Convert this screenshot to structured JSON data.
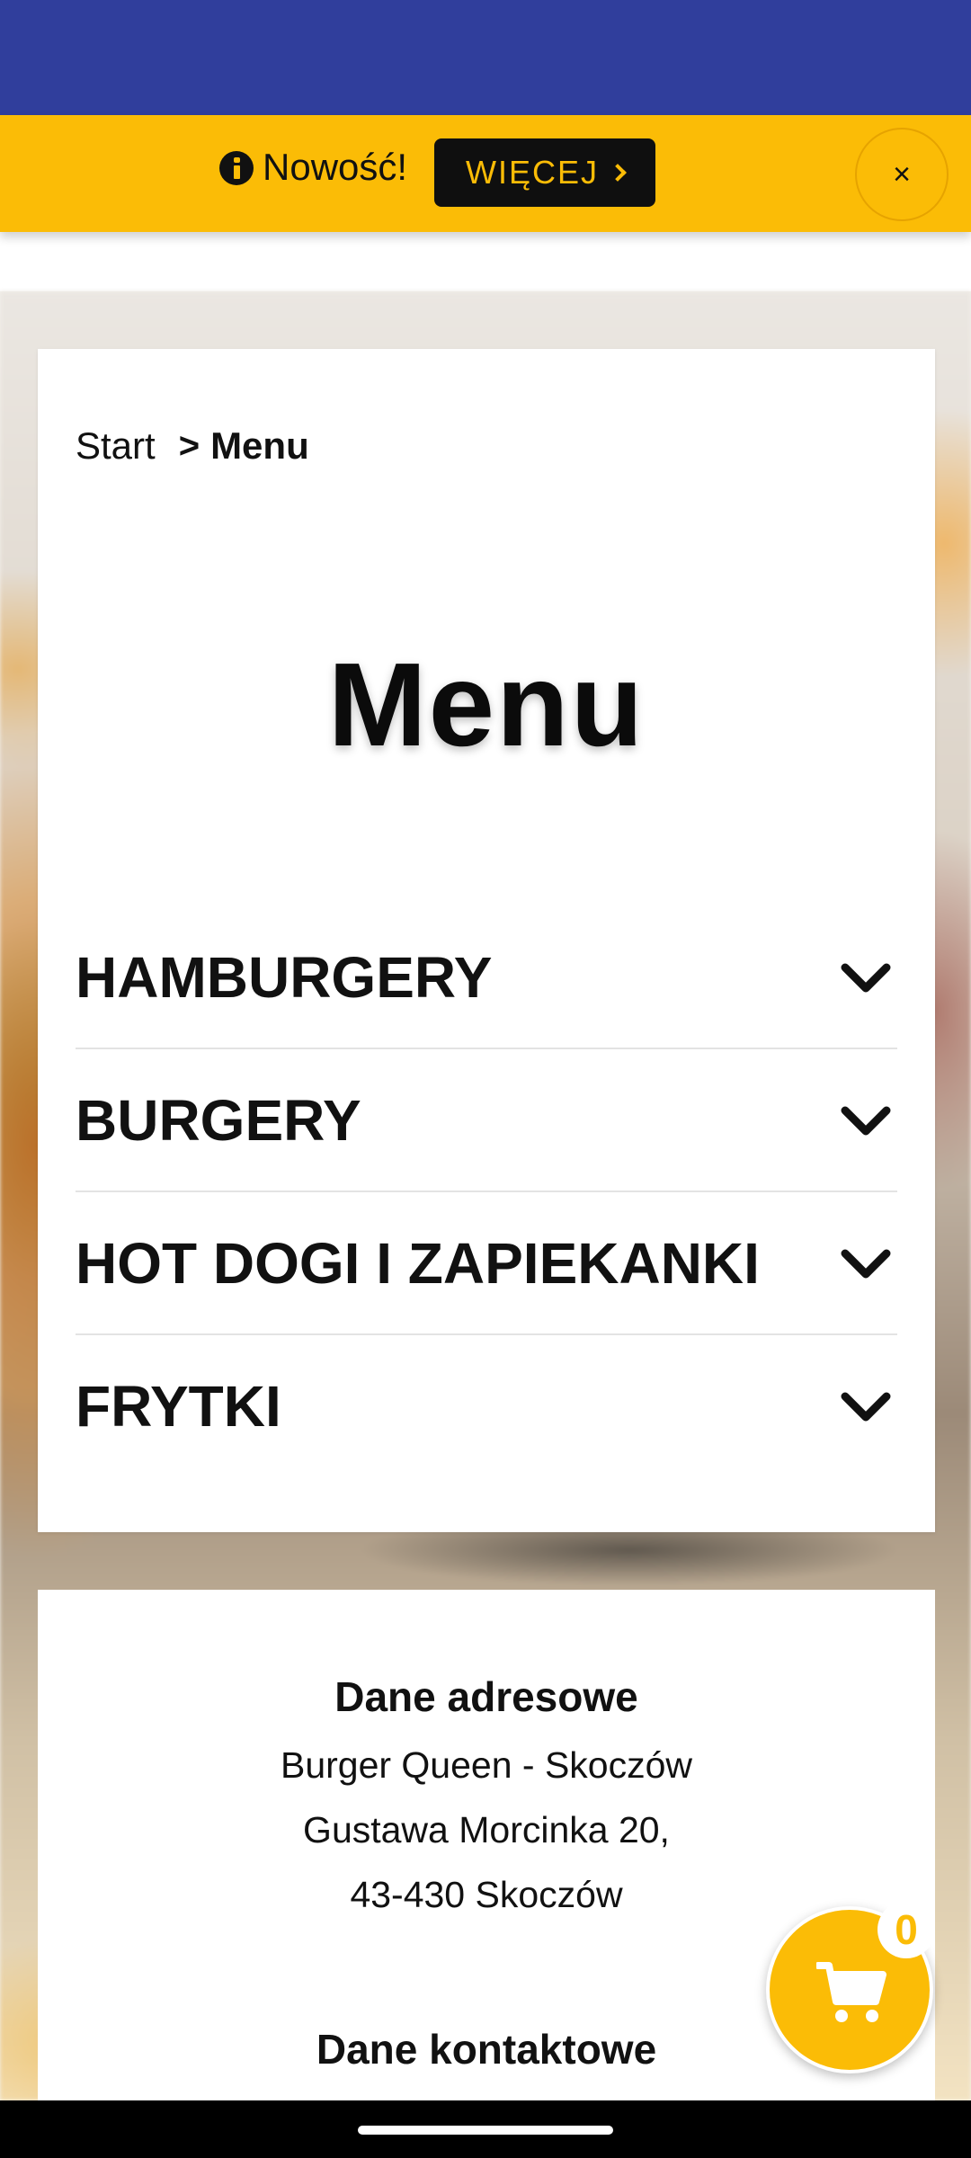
{
  "notice": {
    "text": "Nowość!",
    "more_label": "WIĘCEJ",
    "close_label": "×"
  },
  "breadcrumb": {
    "start": "Start",
    "separator": ">",
    "current": "Menu"
  },
  "page_title": "Menu",
  "categories": [
    {
      "label": "HAMBURGERY"
    },
    {
      "label": "BURGERY"
    },
    {
      "label": "HOT DOGI I ZAPIEKANKI"
    },
    {
      "label": "FRYTKI"
    }
  ],
  "address": {
    "heading": "Dane adresowe",
    "name": "Burger Queen - Skoczów",
    "street": "Gustawa Morcinka 20,",
    "city": "43-430 Skoczów"
  },
  "contact": {
    "heading": "Dane kontaktowe"
  },
  "cart": {
    "count": "0"
  },
  "colors": {
    "top_bar": "#303e9c",
    "accent": "#fbbc06",
    "dark": "#0f0f0f"
  }
}
